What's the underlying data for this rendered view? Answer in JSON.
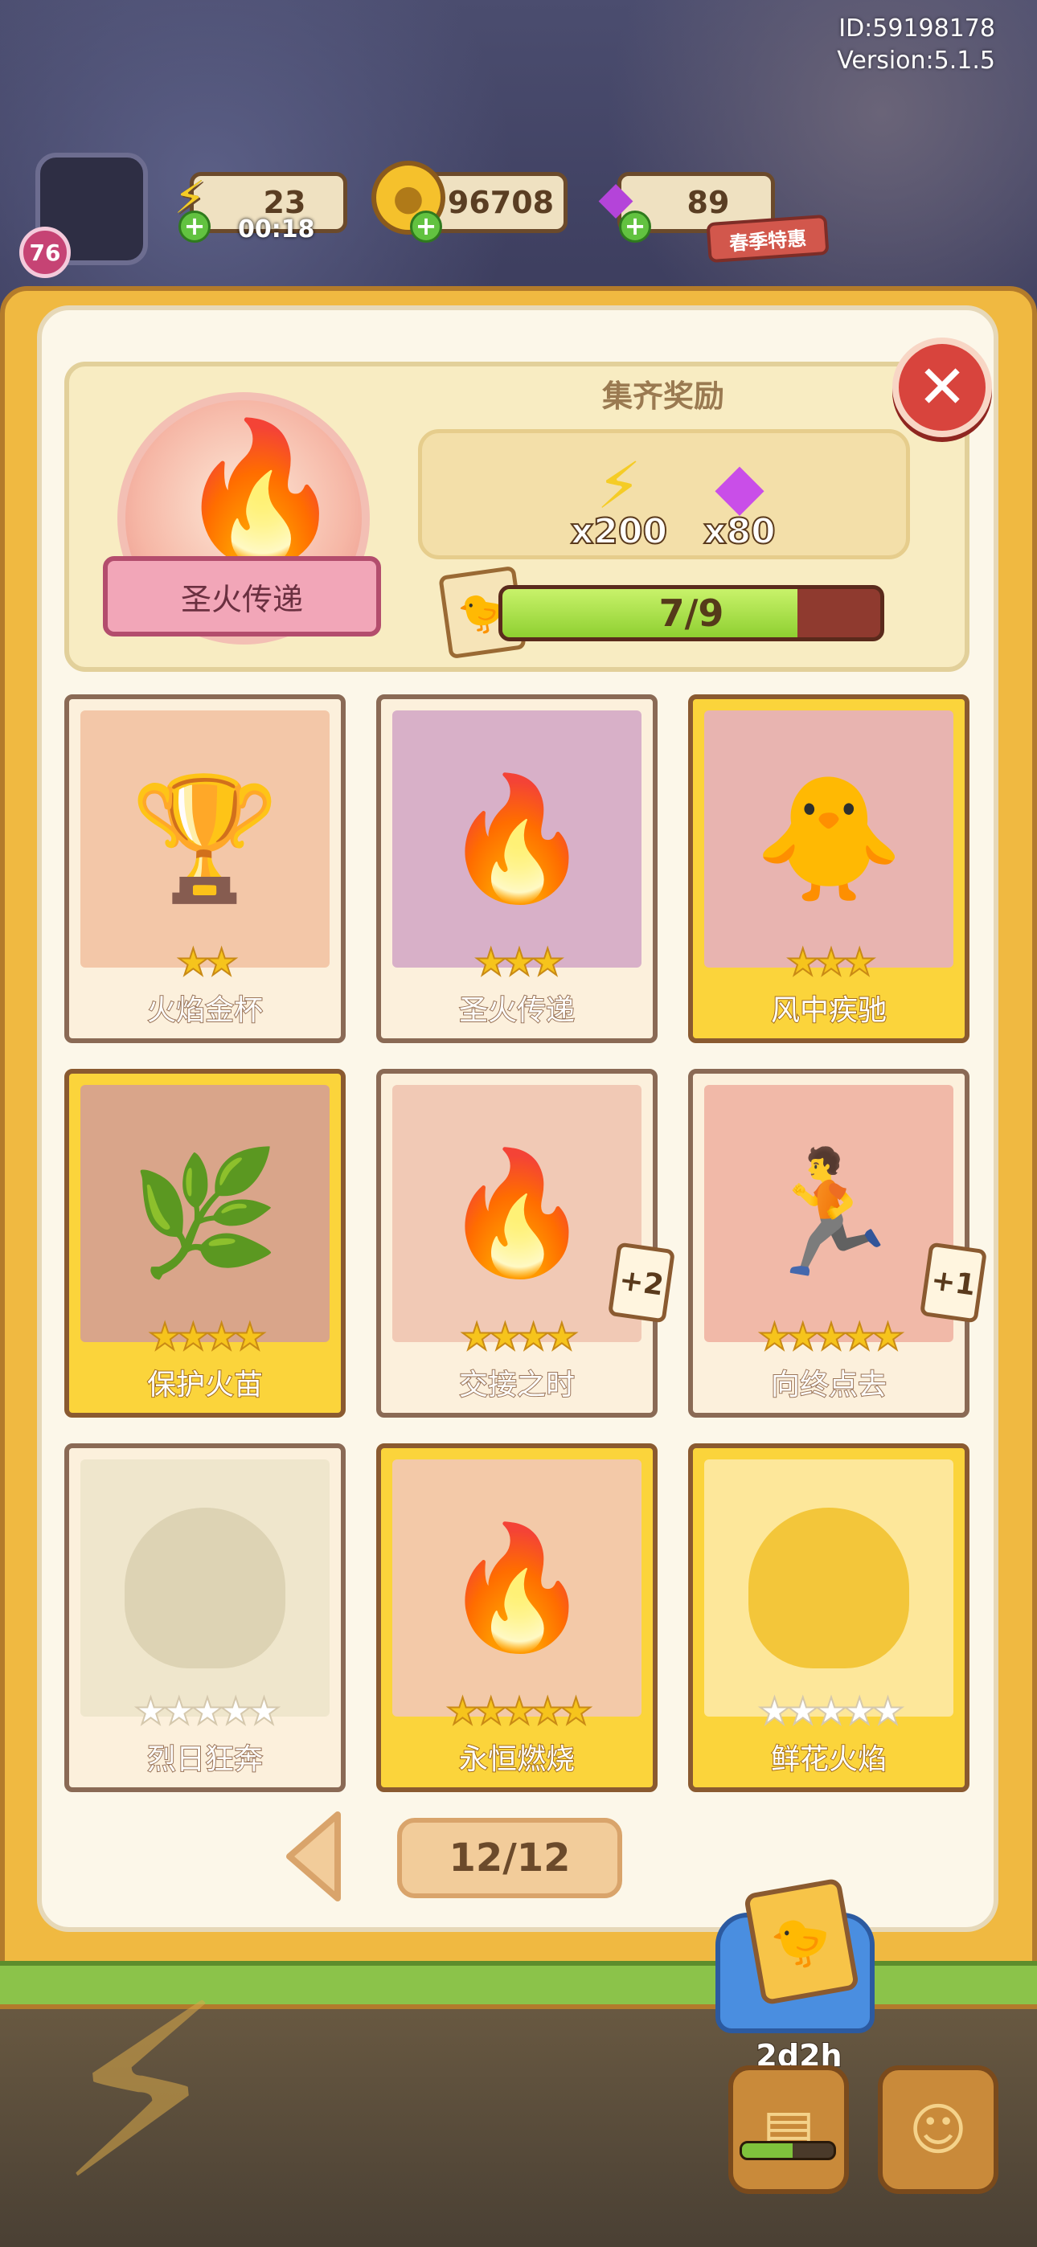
{
  "system": {
    "id_text": "ID:59198178",
    "version_text": "Version:5.1.5"
  },
  "hud": {
    "level": "76",
    "energy": {
      "value": "23",
      "timer": "00:18",
      "icon": "lightning-bolt-icon"
    },
    "coins": {
      "value": "96708",
      "icon": "coin-icon"
    },
    "gems": {
      "value": "89",
      "icon": "purple-gem-icon"
    },
    "promo_label": "春季特惠"
  },
  "album": {
    "emblem_title": "圣火传递",
    "emblem_icon": "torch-flame-icon",
    "reward_title": "集齐奖励",
    "rewards": [
      {
        "icon": "lightning-bolt-icon",
        "symbol": "⚡",
        "qty": "x200",
        "color": "#f5cc26"
      },
      {
        "icon": "purple-gem-icon",
        "symbol": "◆",
        "qty": "x80",
        "color": "#c94ee8"
      }
    ],
    "progress": {
      "text": "7/9",
      "fraction": 0.78
    },
    "cards": [
      {
        "name": "火焰金杯",
        "stars": 2,
        "gold": false,
        "collected": true,
        "art": "🏆",
        "bg": "#f3c7a8"
      },
      {
        "name": "圣火传递",
        "stars": 3,
        "gold": false,
        "collected": true,
        "art": "🔥",
        "bg": "#d8b0c8"
      },
      {
        "name": "风中疾驰",
        "stars": 3,
        "gold": true,
        "collected": true,
        "art": "🐥",
        "bg": "#e8b4b0"
      },
      {
        "name": "保护火苗",
        "stars": 4,
        "gold": true,
        "collected": true,
        "art": "🌿",
        "bg": "#d9a58a"
      },
      {
        "name": "交接之时",
        "stars": 4,
        "gold": false,
        "collected": true,
        "art": "🔥",
        "bg": "#f1c9b5",
        "dup": "+2"
      },
      {
        "name": "向终点去",
        "stars": 5,
        "gold": false,
        "collected": true,
        "art": "🏃",
        "bg": "#f1b9a8",
        "dup": "+1"
      },
      {
        "name": "烈日狂奔",
        "stars": 5,
        "gold": false,
        "collected": false,
        "art": "",
        "bg": "#efe6cc"
      },
      {
        "name": "永恒燃烧",
        "stars": 5,
        "gold": true,
        "collected": true,
        "art": "🔥",
        "bg": "#f3c9a8"
      },
      {
        "name": "鲜花火焰",
        "stars": 5,
        "gold": true,
        "collected": false,
        "art": "",
        "bg": "#fde79a"
      }
    ],
    "page_indicator": "12/12",
    "album_timer": "2d2h"
  },
  "colors": {
    "page_bg": "#fcf7e9",
    "book_frame": "#f0b941",
    "close_red": "#d8443d",
    "progress_green": "#8fd031"
  }
}
